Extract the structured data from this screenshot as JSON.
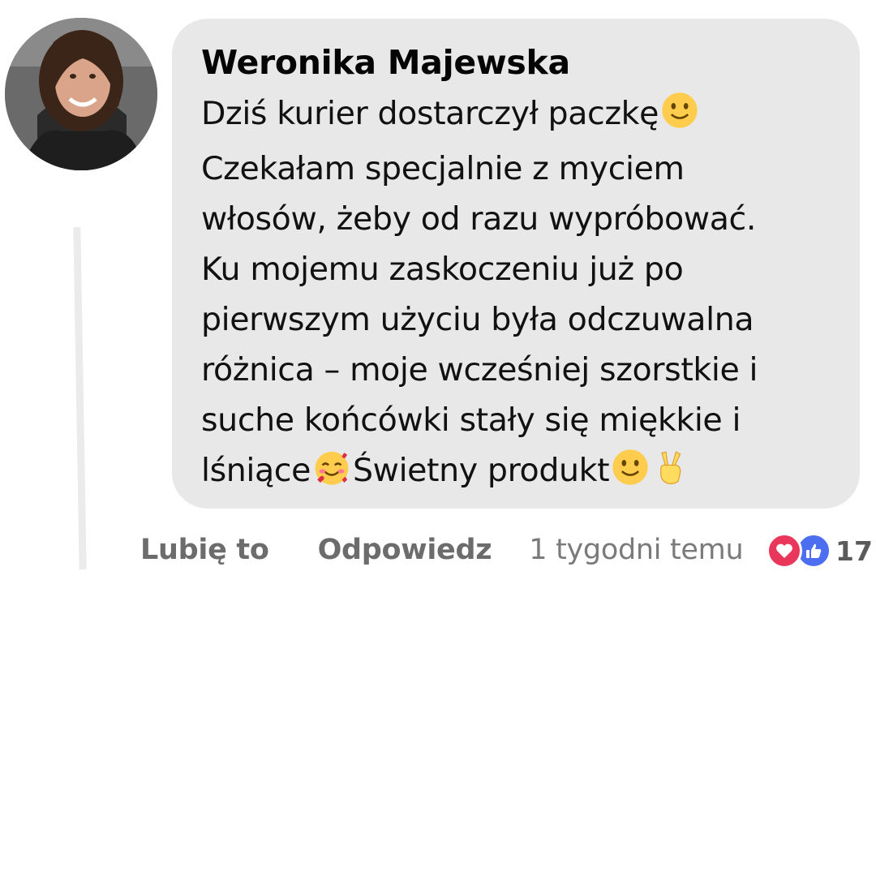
{
  "comment": {
    "author": "Weronika Majewska",
    "lines": [
      "Dziś kurier dostarczył paczkę",
      "Czekałam specjalnie z myciem",
      "włosów, żeby od razu wypróbować.",
      "Ku mojemu zaskoczeniu już po",
      "pierwszym użyciu była odczuwalna",
      "różnica – moje wcześniej szorstkie i",
      "suche końcówki stały się miękkie i",
      "lśniące",
      "Świetny produkt"
    ],
    "emojis": [
      "slightly-smiling-face",
      "smiling-face-with-hearts",
      "slightly-smiling-face",
      "victory-hand"
    ]
  },
  "actions": {
    "like_label": "Lubię to",
    "reply_label": "Odpowiedz",
    "timestamp": "1 tygodni temu"
  },
  "reactions": {
    "icons": [
      "heart-icon",
      "thumbs-up-icon"
    ],
    "count": "17"
  },
  "colors": {
    "bubble": "#e8e8e8",
    "love": "#e8375a",
    "like": "#4e6ef2",
    "action_text": "#6c6c6c"
  }
}
